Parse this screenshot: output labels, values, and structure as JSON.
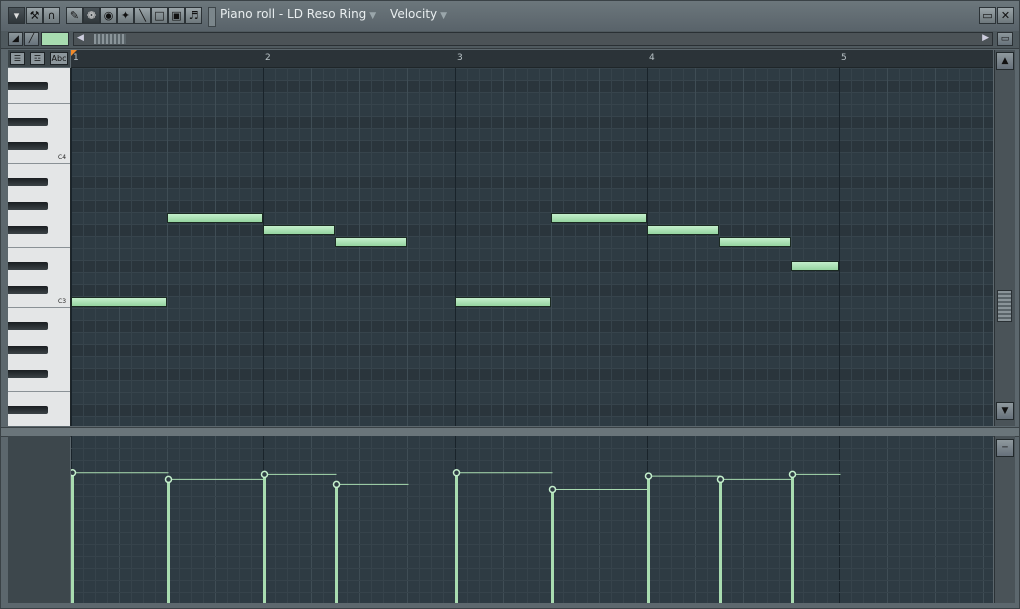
{
  "window": {
    "title": "Piano roll - LD Reso Ring",
    "target": "Velocity"
  },
  "icons": {
    "menu": "menu-arrow-icon",
    "wrench": "wrench-icon",
    "magnet": "magnet-icon",
    "pencil": "pencil-tool-icon",
    "brush": "paint-brush-icon",
    "delete": "delete-tool-icon",
    "mute": "mute-tool-icon",
    "slice": "slice-tool-icon",
    "select": "select-tool-icon",
    "zoom": "zoom-tool-icon",
    "playback": "speaker-icon"
  },
  "keyboard": {
    "label_abc": "Abc",
    "octave_labels": [
      "C4",
      "C3"
    ]
  },
  "timeline": {
    "bars": [
      "1",
      "2",
      "3",
      "4",
      "5"
    ]
  },
  "colors": {
    "note": "#a8dcb0",
    "grid_bg": "#2e3b43",
    "playhead": "#f08a2a"
  },
  "notes": [
    {
      "start": 1.0,
      "length": 0.5,
      "pitch": 48
    },
    {
      "start": 1.5,
      "length": 0.5,
      "pitch": 55
    },
    {
      "start": 2.0,
      "length": 0.375,
      "pitch": 54
    },
    {
      "start": 2.375,
      "length": 0.375,
      "pitch": 53
    },
    {
      "start": 3.0,
      "length": 0.5,
      "pitch": 48
    },
    {
      "start": 3.5,
      "length": 0.5,
      "pitch": 55
    },
    {
      "start": 4.0,
      "length": 0.375,
      "pitch": 54
    },
    {
      "start": 4.375,
      "length": 0.375,
      "pitch": 53
    },
    {
      "start": 4.75,
      "length": 0.25,
      "pitch": 51
    }
  ],
  "velocities": [
    0.78,
    0.74,
    0.77,
    0.71,
    0.78,
    0.68,
    0.76,
    0.74,
    0.77
  ]
}
